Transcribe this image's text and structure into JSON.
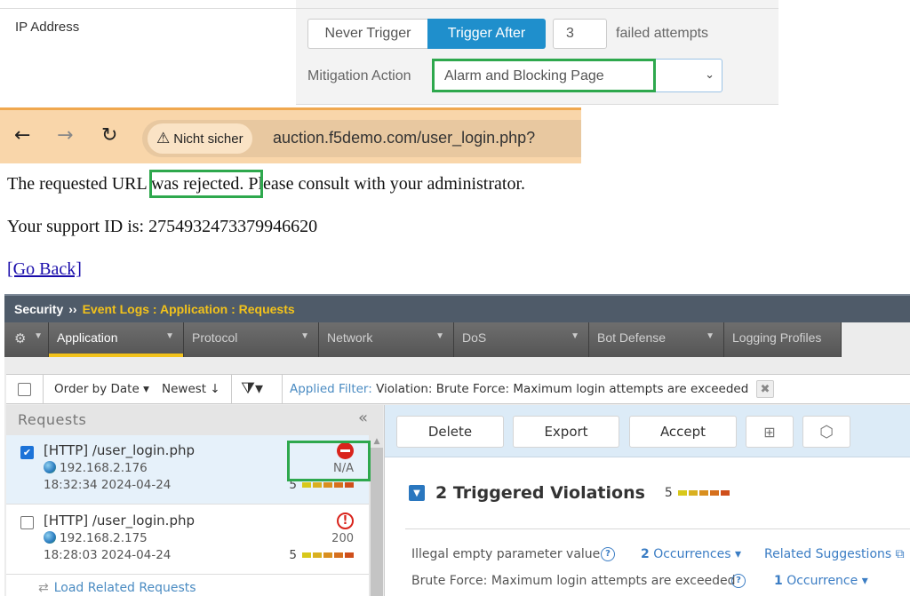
{
  "settings": {
    "row_label": "IP Address",
    "trigger_options": [
      "Never Trigger",
      "Trigger After"
    ],
    "selected_trigger": "Trigger After",
    "attempts_value": "3",
    "attempts_suffix": "failed attempts",
    "mitigation_label": "Mitigation Action",
    "mitigation_value": "Alarm and Blocking Page"
  },
  "browser": {
    "security_label": "Nicht sicher",
    "url": "auction.f5demo.com/user_login.php?",
    "icons": {
      "back": "arrow-left-icon",
      "forward": "arrow-right-icon",
      "reload": "reload-icon",
      "warning": "warning-triangle-icon"
    }
  },
  "rejection_page": {
    "line1": "The requested URL was rejected. Please consult with your administrator.",
    "line1_pre": "The requested UR",
    "line1_highlight": "L was rejected.",
    "line1_post": " Please consult with your administrator.",
    "line2": "Your support ID is: 2754932473379946620",
    "go_back": "[Go Back]"
  },
  "f5": {
    "breadcrumb": {
      "root": "Security",
      "separator": "››",
      "path": "Event Logs : Application : Requests"
    },
    "tabs": [
      {
        "label": "Application",
        "active": true,
        "dropdown": true
      },
      {
        "label": "Protocol",
        "active": false,
        "dropdown": true
      },
      {
        "label": "Network",
        "active": false,
        "dropdown": true
      },
      {
        "label": "DoS",
        "active": false,
        "dropdown": true
      },
      {
        "label": "Bot Defense",
        "active": false,
        "dropdown": true
      },
      {
        "label": "Logging Profiles",
        "active": false,
        "dropdown": false
      }
    ],
    "filter_bar": {
      "order_by": "Order by Date ▾",
      "sort": "Newest ↓",
      "filter_icon": "⧩▾",
      "applied_label": "Applied Filter:",
      "applied_value": " Violation: Brute Force: Maximum login attempts are exceeded",
      "clear": "✖"
    },
    "requests": {
      "title": "Requests",
      "collapse": "«",
      "items": [
        {
          "url": "[HTTP] /user_login.php",
          "ip": "192.168.2.176",
          "time": "18:32:34 2024-04-24",
          "status": "blocked",
          "code": "N/A",
          "score": "5",
          "checked": true
        },
        {
          "url": "[HTTP] /user_login.php",
          "ip": "192.168.2.175",
          "time": "18:28:03 2024-04-24",
          "status": "alert",
          "code": "200",
          "score": "5",
          "checked": false
        }
      ],
      "load_related": "Load Related Requests"
    },
    "severity_colors": [
      "#d8c81a",
      "#d9b020",
      "#d98f1f",
      "#d6701d",
      "#cf4f1b"
    ],
    "toolbar": {
      "delete": "Delete",
      "export": "Export",
      "accept": "Accept",
      "comment_icon": "⊞",
      "tag_icon": "⬡"
    },
    "violations": {
      "title": "2 Triggered Violations",
      "score": "5",
      "rows": [
        {
          "name": "Illegal empty parameter value",
          "count": "2",
          "count_label": " Occurrences ▾",
          "related": "Related Suggestions ⧉"
        },
        {
          "name": "Brute Force: Maximum login attempts are exceeded",
          "count": "1",
          "count_label": " Occurrence ▾"
        }
      ]
    }
  },
  "highlight_color": "#2ea84d"
}
